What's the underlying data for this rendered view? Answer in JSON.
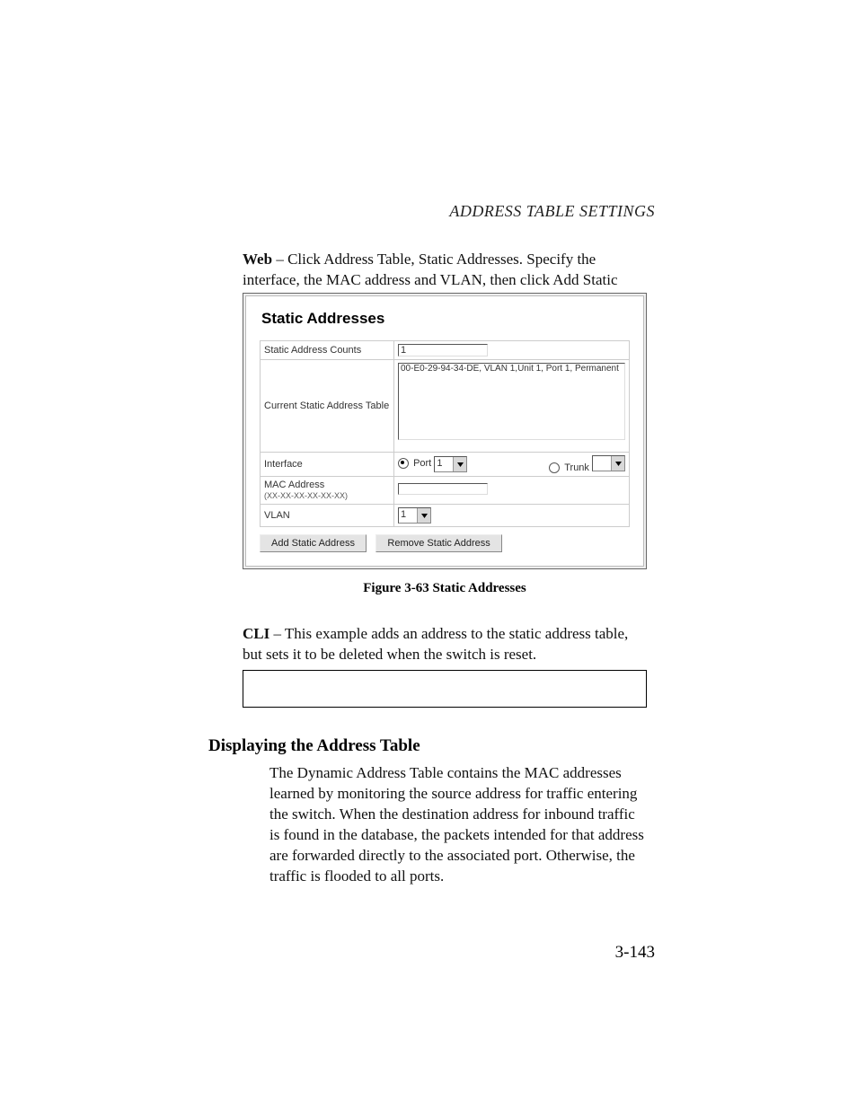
{
  "header": {
    "running_title": "ADDRESS TABLE SETTINGS"
  },
  "paragraphs": {
    "web_label": "Web",
    "web_text": " – Click Address Table, Static Addresses. Specify the interface, the MAC address and VLAN, then click Add Static Address.",
    "figure_caption": "Figure 3-63  Static Addresses",
    "cli_label": "CLI",
    "cli_text": " – This example adds an address to the static address table, but sets it to be deleted when the switch is reset.",
    "section_heading": "Displaying the Address Table",
    "body_text": "The Dynamic Address Table contains the MAC addresses learned by monitoring the source address for traffic entering the switch. When the destination address for inbound traffic is found in the database, the packets intended for that address are forwarded directly to the associated port. Otherwise, the traffic is flooded to all ports."
  },
  "page_number": "3-143",
  "gui": {
    "title": "Static Addresses",
    "rows": {
      "counts_label": "Static Address Counts",
      "counts_value": "1",
      "table_label": "Current Static Address Table",
      "table_entry": "00-E0-29-94-34-DE, VLAN 1,Unit 1, Port 1, Permanent",
      "interface_label": "Interface",
      "port_label": "Port",
      "port_value": "1",
      "trunk_label": "Trunk",
      "trunk_value": "",
      "mac_label": "MAC Address",
      "mac_hint": "(XX-XX-XX-XX-XX-XX)",
      "mac_value": "",
      "vlan_label": "VLAN",
      "vlan_value": "1"
    },
    "buttons": {
      "add": "Add Static Address",
      "remove": "Remove Static Address"
    }
  }
}
